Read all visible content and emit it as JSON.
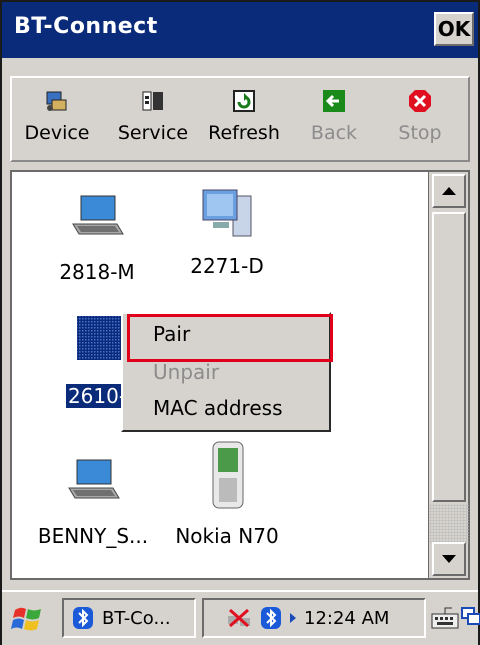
{
  "window": {
    "title": "BT-Connect",
    "ok_label": "OK"
  },
  "toolbar": {
    "buttons": [
      {
        "label": "Device",
        "icon": "device-icon",
        "enabled": true
      },
      {
        "label": "Service",
        "icon": "service-icon",
        "enabled": true
      },
      {
        "label": "Refresh",
        "icon": "refresh-icon",
        "enabled": true
      },
      {
        "label": "Back",
        "icon": "back-icon",
        "enabled": false
      },
      {
        "label": "Stop",
        "icon": "stop-icon",
        "enabled": false
      }
    ]
  },
  "devices": [
    {
      "name": "2818-M",
      "icon": "laptop-icon"
    },
    {
      "name": "2271-D",
      "icon": "desktop-computer-icon"
    },
    {
      "name": "2610-",
      "icon": "computer-icon",
      "selected": true
    },
    {
      "name": "BENNY_S...",
      "icon": "laptop-icon"
    },
    {
      "name": "Nokia N70",
      "icon": "phone-icon"
    }
  ],
  "context_menu": {
    "items": [
      {
        "label": "Pair",
        "enabled": true,
        "highlighted": true
      },
      {
        "label": "Unpair",
        "enabled": false
      },
      {
        "label": "MAC address",
        "enabled": true
      }
    ]
  },
  "taskbar": {
    "task_label": "BT-Co...",
    "time": "12:24 AM"
  },
  "colors": {
    "titlebar": "#0a2a7a",
    "highlight_border": "#e0001c",
    "selection": "#0a2a7a"
  }
}
